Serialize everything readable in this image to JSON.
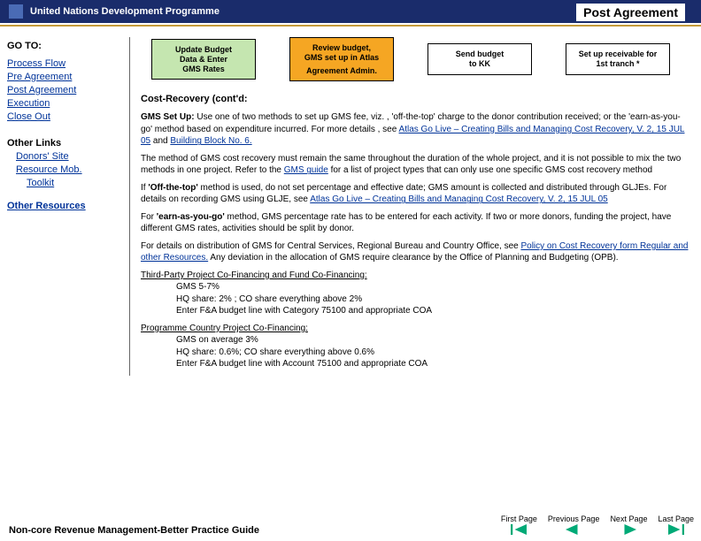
{
  "header": {
    "org": "United Nations Development Programme",
    "page_title": "Post Agreement"
  },
  "flow": {
    "b1_line1": "Update Budget",
    "b1_line2": "Data & Enter",
    "b1_line3": "GMS Rates",
    "b2_line1": "Review budget,",
    "b2_line2": "GMS set up in Atlas",
    "b2_line3": "Agreement Admin.",
    "b3_line1": "Send budget",
    "b3_line2": "to KK",
    "b4_line1": "Set up receivable for",
    "b4_line2": "1st tranch *"
  },
  "sidebar": {
    "goto": "GO TO:",
    "links": {
      "process_flow": "Process Flow",
      "pre_agreement": "Pre Agreement",
      "post_agreement": "Post Agreement",
      "execution": "Execution",
      "close_out": "Close Out"
    },
    "other_links": "Other Links",
    "donors_site": "Donors' Site",
    "resource_mob": "Resource Mob.",
    "toolkit": "Toolkit",
    "other_resources": "Other Resources"
  },
  "content": {
    "recovery_heading": "Cost-Recovery (cont'd:",
    "gms_heading": "GMS Set Up:",
    "p1a": "  Use one of two methods to set up GMS fee, viz. , 'off-the-top' charge to the donor contribution received; or the  'earn-as-you-go'  method based on expenditure incurred.  For more details , see  ",
    "link_atlas": "Atlas Go Live – Creating Bills and Managing Cost Recovery, V. 2, 15 JUL 05",
    "p1b": " and ",
    "link_bb6": "Building Block No.  6.",
    "p2a": "The method of GMS cost recovery must remain the same throughout the duration of the whole project, and it is not possible to mix the two methods in one project.  Refer to the ",
    "link_gms_guide": "GMS guide",
    "p2b": " for a list of project types that can only use one specific GMS cost recovery method",
    "p3a_pre": "If  ",
    "p3a_bold": "'Off-the-top'",
    "p3a": " method is used,  do not set percentage and effective date;  GMS amount is collected and distributed  through  GLJEs.  For  details  on recording GMS using GLJE, see  ",
    "link_atlas2": "Atlas Go Live – Creating Bills and Managing Cost Recovery, V. 2, 15 JUL 05",
    "p4_pre": "For ",
    "p4_bold": "'earn-as-you-go'",
    "p4": " method, GMS  percentage rate has to be entered for each activity. If two or more donors,  funding the project, have  different GMS rates, activities should be split by donor.",
    "p5a": "For details on distribution of GMS for Central Services, Regional Bureau and Country Office, see  ",
    "link_policy": "Policy on Cost Recovery form Regular and other Resources.",
    "p5b": " Any deviation in the allocation of GMS require clearance by the Office of  Planning and Budgeting (OPB).",
    "tp_heading": "Third-Party Project Co-Financing and Fund Co-Financing:",
    "tp_l1": "GMS 5-7%",
    "tp_l2": "HQ share: 2% ; CO share  everything above 2%",
    "tp_l3": "Enter F&A budget line with Category 75100 and appropriate COA",
    "pc_heading": "Programme Country Project Co-Financing:",
    "pc_l1": "GMS on average 3%",
    "pc_l2": "HQ share: 0.6%; CO share everything above 0.6%",
    "pc_l3": "Enter F&A budget line with Account 75100 and appropriate COA"
  },
  "footer": {
    "title": "Non-core Revenue Management-Better Practice Guide",
    "first": "First Page",
    "prev": "Previous Page",
    "next": "Next Page",
    "last": "Last Page"
  }
}
